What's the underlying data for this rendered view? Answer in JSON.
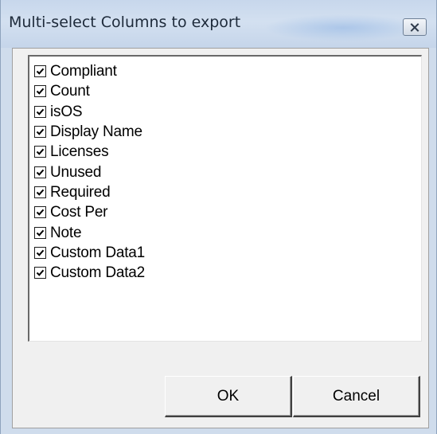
{
  "window": {
    "title": "Multi-select Columns to export",
    "close_icon": "close-icon"
  },
  "columns_list": {
    "items": [
      {
        "label": "Compliant",
        "checked": true
      },
      {
        "label": "Count",
        "checked": true
      },
      {
        "label": "isOS",
        "checked": true
      },
      {
        "label": "Display Name",
        "checked": true
      },
      {
        "label": "Licenses",
        "checked": true
      },
      {
        "label": "Unused",
        "checked": true
      },
      {
        "label": "Required",
        "checked": true
      },
      {
        "label": "Cost Per",
        "checked": true
      },
      {
        "label": "Note",
        "checked": true
      },
      {
        "label": "Custom Data1",
        "checked": true
      },
      {
        "label": "Custom Data2",
        "checked": true
      }
    ]
  },
  "buttons": {
    "ok_label": "OK",
    "cancel_label": "Cancel"
  }
}
